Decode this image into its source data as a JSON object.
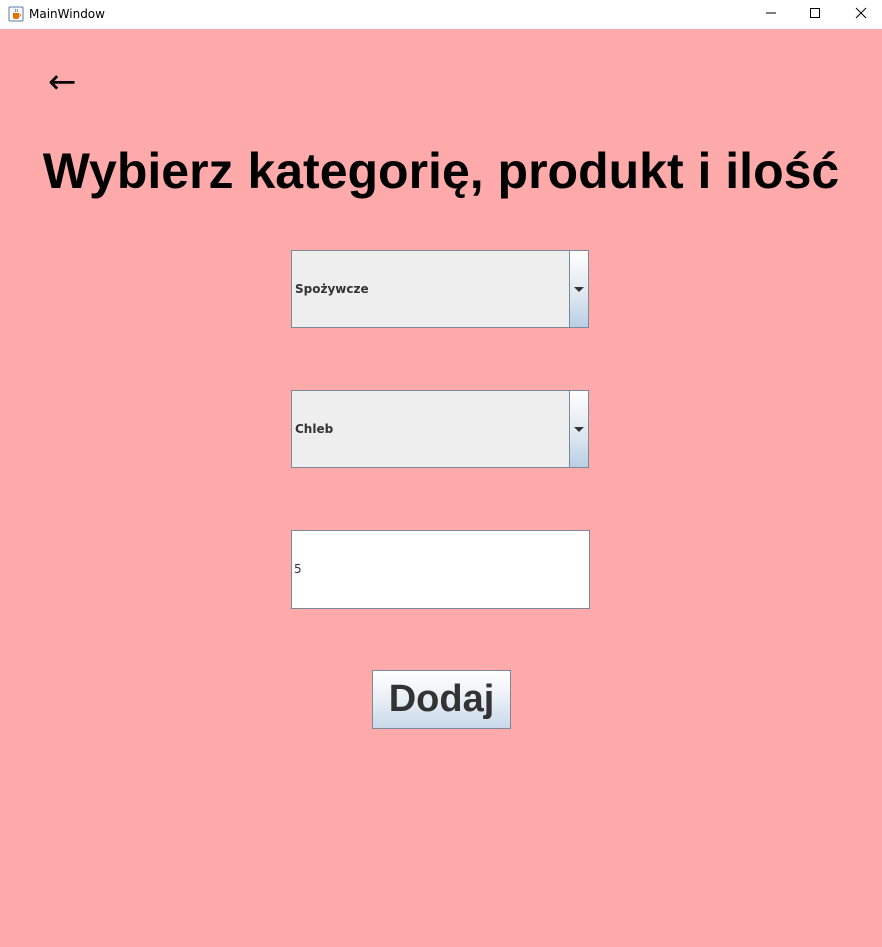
{
  "window": {
    "title": "MainWindow",
    "app_icon": "java-cup-icon",
    "controls": [
      "minimize-icon",
      "maximize-icon",
      "close-icon"
    ]
  },
  "back_button": {
    "label": "←"
  },
  "heading": "Wybierz kategorię, produkt i ilość",
  "category_select": {
    "selected": "Spożywcze"
  },
  "product_select": {
    "selected": "Chleb"
  },
  "quantity_field": {
    "value": "5"
  },
  "add_button": {
    "label": "Dodaj"
  },
  "colors": {
    "background": "#ffaaaa",
    "titlebar": "#ffffff",
    "combo_bg": "#eeeeee",
    "border": "#7a8a99"
  }
}
